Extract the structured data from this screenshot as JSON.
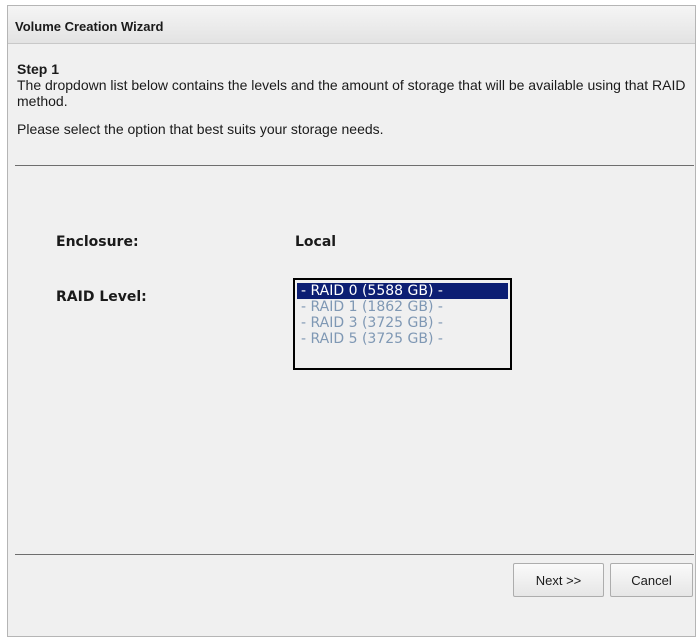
{
  "dialog": {
    "title": "Volume Creation Wizard"
  },
  "step": {
    "heading": "Step 1",
    "description": "The dropdown list below contains the levels and the amount of storage that will be available using that RAID method.",
    "advice": "Please select the option that best suits your storage needs."
  },
  "form": {
    "enclosure_label": "Enclosure:",
    "enclosure_value": "Local",
    "raid_label": "RAID Level:",
    "raid_options": [
      "- RAID 0 (5588 GB) -",
      "- RAID 1 (1862 GB) -",
      "- RAID 3 (3725 GB) -",
      "- RAID 5 (3725 GB) -"
    ],
    "raid_selected_index": 0
  },
  "buttons": {
    "next_label": "Next >>",
    "cancel_label": "Cancel"
  },
  "colors": {
    "selection_bg": "#0c1e73",
    "option_text": "#7f98b4"
  }
}
